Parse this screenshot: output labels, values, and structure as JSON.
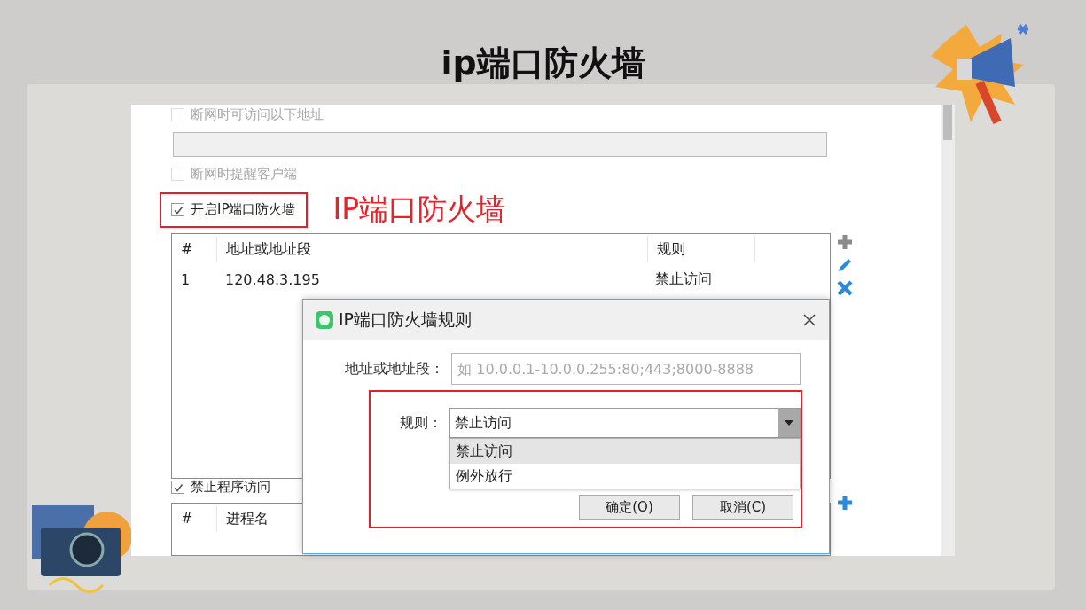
{
  "slide": {
    "title": "ip端口防火墙",
    "annotation": "IP端口防火墙"
  },
  "settings": {
    "offline_access": {
      "label": "断网时可访问以下地址",
      "checked": false,
      "disabled": true
    },
    "offline_notify": {
      "label": "断网时提醒客户端",
      "checked": false,
      "disabled": true
    },
    "ip_firewall": {
      "label": "开启IP端口防火墙",
      "checked": true,
      "disabled": false,
      "highlighted": true
    },
    "ip_table": {
      "columns": [
        "#",
        "地址或地址段",
        "规则"
      ],
      "rows": [
        [
          "1",
          "120.48.3.195",
          "禁止访问"
        ]
      ]
    },
    "program_block": {
      "label": "禁止程序访问",
      "checked": true,
      "disabled": false
    },
    "program_table": {
      "columns": [
        "#",
        "进程名"
      ]
    }
  },
  "dialog": {
    "title": "IP端口防火墙规则",
    "address": {
      "label": "地址或地址段：",
      "placeholder": "如 10.0.0.1-10.0.0.255:80;443;8000-8888"
    },
    "rule": {
      "label": "规则：",
      "value": "禁止访问",
      "highlighted": true,
      "options": [
        {
          "label": "禁止访问",
          "selected": true
        },
        {
          "label": "例外放行",
          "selected": false
        }
      ]
    },
    "buttons": [
      "确定(O)",
      "取消(C)"
    ]
  }
}
